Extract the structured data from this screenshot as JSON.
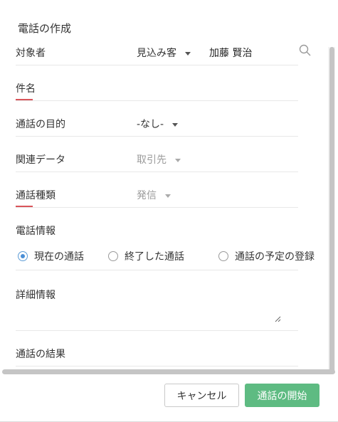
{
  "dialog": {
    "title": "電話の作成"
  },
  "fields": {
    "who": {
      "label": "対象者",
      "type_value": "見込み客",
      "value": "加藤 賢治"
    },
    "subject": {
      "label": "件名"
    },
    "purpose": {
      "label": "通話の目的",
      "value": "-なし-"
    },
    "related": {
      "label": "関連データ",
      "value": "取引先"
    },
    "call_type": {
      "label": "通話種類",
      "value": "発信"
    },
    "call_info": {
      "label": "電話情報",
      "options": [
        "現在の通話",
        "終了した通話",
        "通話の予定の登録"
      ],
      "selected": "現在の通話"
    },
    "details": {
      "label": "詳細情報"
    },
    "result": {
      "label": "通話の結果"
    }
  },
  "buttons": {
    "cancel": "キャンセル",
    "start": "通話の開始"
  },
  "colors": {
    "primary_button": "#5ebb82",
    "required_marker": "#d9545a",
    "radio_selected": "#4a8fd6"
  }
}
